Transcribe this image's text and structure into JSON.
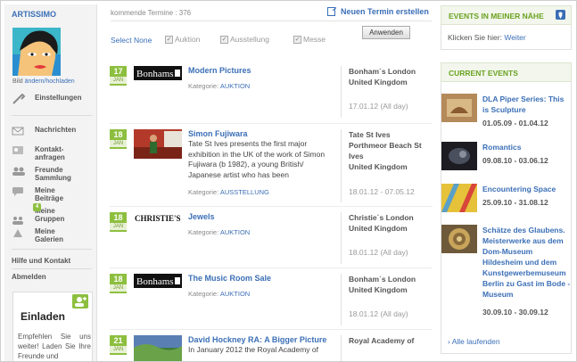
{
  "sidebar": {
    "brand": "ARTISSIMO",
    "avatar_caption_prefix": "Bild ",
    "avatar_caption_link": "ändern/hochladen",
    "menu": [
      {
        "label": "Einstellungen",
        "icon": "wrench-icon"
      },
      {
        "label": "Nachrichten",
        "icon": "envelope-icon"
      },
      {
        "label": "Kontakt-\nanfragen",
        "icon": "contact-request-icon"
      },
      {
        "label": "Freunde\nSammlung",
        "icon": "friends-icon"
      },
      {
        "label": "Meine\nBeiträge",
        "icon": "comments-icon"
      },
      {
        "label": "Meine\nGruppen",
        "icon": "groups-icon",
        "badge": "4"
      },
      {
        "label": "Meine\nGalerien",
        "icon": "gallery-icon"
      }
    ],
    "help": "Hilfe und Kontakt",
    "logout": "Abmelden",
    "invite": {
      "title": "Einladen",
      "body": "Empfehlen Sie uns weiter! Laden Sie Ihre Freunde und"
    }
  },
  "main": {
    "count_label": "kommende Termine : 376",
    "new_event": "Neuen Termin erstellen",
    "select_none": "Select None",
    "filters": [
      {
        "label": "Auktion",
        "checked": true
      },
      {
        "label": "Ausstellung",
        "checked": true
      },
      {
        "label": "Messe",
        "checked": true
      }
    ],
    "apply_button": "Anwenden",
    "events": [
      {
        "day": "17",
        "month": "JAN",
        "title": "Modern Pictures",
        "description": "",
        "category_label": "Kategorie:",
        "category": "AUKTION",
        "location": "Bonham´s London\nUnited Kingdom",
        "dates": "17.01.12 (All day)",
        "thumb": "bonhams"
      },
      {
        "day": "18",
        "month": "JAN",
        "title": "Simon Fujiwara",
        "description": "Tate St Ives presents the first major exhibition in the UK of the work of Simon Fujiwara (b 1982), a young British/ Japanese artist who has been",
        "category_label": "Kategorie:",
        "category": "AUSSTELLUNG",
        "location": "Tate St Ives\nPorthmeor Beach St Ives\nUnited Kingdom",
        "dates": "18.01.12 - 07.05.12",
        "thumb": "photo"
      },
      {
        "day": "18",
        "month": "JAN",
        "title": "Jewels",
        "description": "",
        "category_label": "Kategorie:",
        "category": "AUKTION",
        "location": "Christie´s London\nUnited Kingdom",
        "dates": "18.01.12 (All day)",
        "thumb": "christies"
      },
      {
        "day": "18",
        "month": "JAN",
        "title": "The Music Room Sale",
        "description": "",
        "category_label": "Kategorie:",
        "category": "AUKTION",
        "location": "Bonham´s London\nUnited Kingdom",
        "dates": "18.01.12 (All day)",
        "thumb": "bonhams"
      },
      {
        "day": "21",
        "month": "JAN",
        "title": "David Hockney RA: A Bigger Picture",
        "description": "In January 2012 the Royal Academy of",
        "category_label": "",
        "category": "",
        "location": "Royal Academy of",
        "dates": "",
        "thumb": "photo"
      }
    ]
  },
  "right": {
    "nearby_title": "EVENTS IN MEINER NÄHE",
    "nearby_prompt": "Klicken Sie hier:",
    "nearby_link": "Weiter",
    "current_title": "CURRENT EVENTS",
    "current": [
      {
        "title": "DLA Piper Series: This is Sculpture",
        "dates": "01.05.09 - 01.04.12"
      },
      {
        "title": "Romantics",
        "dates": "09.08.10 - 03.06.12"
      },
      {
        "title": "Encountering Space",
        "dates": "25.09.10 - 31.08.12"
      },
      {
        "title": "Schätze des Glaubens. Meisterwerke aus dem Dom-Museum Hildesheim und dem Kunstgewerbemuseum Berlin zu Gast im Bode -Museum",
        "dates": "30.09.10 - 30.09.12"
      }
    ],
    "all_link": "› Alle laufenden"
  },
  "colors": {
    "accent_blue": "#3b6fb6",
    "accent_green": "#8dbf3f"
  }
}
